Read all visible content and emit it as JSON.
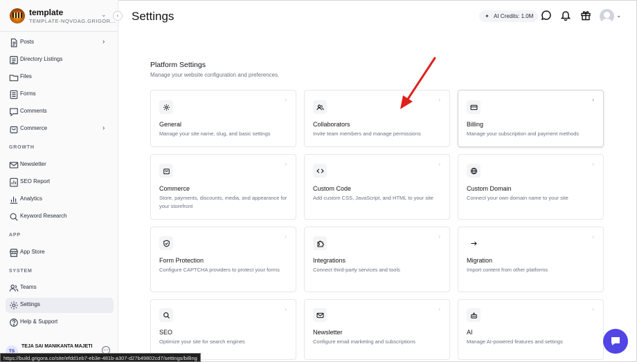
{
  "brand": {
    "name": "template",
    "subdomain": "TEMPLATE-NQVDAG.GRIGOR..."
  },
  "sidebar": {
    "items": [
      {
        "label": "Posts",
        "icon": "document-icon",
        "chevron": true
      },
      {
        "label": "Directory Listings",
        "icon": "list-icon"
      },
      {
        "label": "Files",
        "icon": "folder-icon"
      },
      {
        "label": "Forms",
        "icon": "form-icon"
      },
      {
        "label": "Comments",
        "icon": "comment-icon"
      },
      {
        "label": "Commerce",
        "icon": "bag-icon",
        "chevron": true
      }
    ],
    "growth_label": "GROWTH",
    "growth": [
      {
        "label": "Newsletter",
        "icon": "mail-icon"
      },
      {
        "label": "SEO Report",
        "icon": "report-icon"
      },
      {
        "label": "Analytics",
        "icon": "chart-icon"
      },
      {
        "label": "Keyword Research",
        "icon": "search-icon"
      }
    ],
    "app_label": "APP",
    "app": [
      {
        "label": "App Store",
        "icon": "store-icon"
      }
    ],
    "system_label": "SYSTEM",
    "system": [
      {
        "label": "Teams",
        "icon": "users-icon"
      },
      {
        "label": "Settings",
        "icon": "gear-icon",
        "active": true
      },
      {
        "label": "Help & Support",
        "icon": "help-icon"
      }
    ],
    "user": {
      "initials": "TS",
      "name": "TEJA SAI MANIKANTA MAJETI"
    }
  },
  "status_url": "https://build.grigora.co/site/efdd1eb7-eb3e-481b-a307-d27b49802cd7/settings/billing",
  "header": {
    "title": "Settings",
    "credits": "AI Credits: 1.0M"
  },
  "content": {
    "section_title": "Platform Settings",
    "section_desc": "Manage your website configuration and preferences.",
    "cards": [
      {
        "title": "General",
        "desc": "Manage your site name, slug, and basic settings",
        "icon": "gear-icon"
      },
      {
        "title": "Collaborators",
        "desc": "Invite team members and manage permissions",
        "icon": "users-icon"
      },
      {
        "title": "Billing",
        "desc": "Manage your subscription and payment methods",
        "icon": "credit-card-icon"
      },
      {
        "title": "Commerce",
        "desc": "Store, payments, discounts, media, and appearance for your storefront",
        "icon": "bag-icon"
      },
      {
        "title": "Custom Code",
        "desc": "Add custom CSS, JavaScript, and HTML to your site",
        "icon": "code-icon"
      },
      {
        "title": "Custom Domain",
        "desc": "Connect your own domain name to your site",
        "icon": "globe-icon"
      },
      {
        "title": "Form Protection",
        "desc": "Configure CAPTCHA providers to protect your forms",
        "icon": "shield-icon"
      },
      {
        "title": "Integrations",
        "desc": "Connect third-party services and tools",
        "icon": "puzzle-icon"
      },
      {
        "title": "Migration",
        "desc": "Import content from other platforms",
        "icon": "arrow-right-icon"
      },
      {
        "title": "SEO",
        "desc": "Optimize your site for search engines",
        "icon": "search-icon"
      },
      {
        "title": "Newsletter",
        "desc": "Configure email marketing and subscriptions",
        "icon": "mail-icon"
      },
      {
        "title": "AI",
        "desc": "Manage AI-powered features and settings",
        "icon": "robot-icon"
      }
    ]
  },
  "colors": {
    "accent": "#5145e5",
    "annotation_arrow": "#e0201b",
    "active_bg": "#ececf3"
  }
}
